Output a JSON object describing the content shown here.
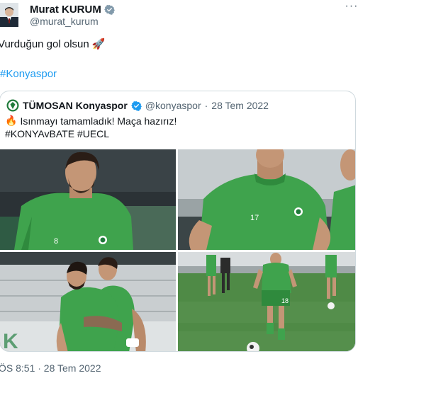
{
  "author": {
    "display_name": "Murat KURUM",
    "handle": "@murat_kurum",
    "verified_icon": "verified-badge-icon",
    "avatar_icon": "profile-avatar"
  },
  "more_label": "···",
  "tweet": {
    "text": "Vurduğun gol olsun 🚀",
    "hashtag": "#Konyaspor",
    "timestamp": "ÖS 8:51 · 28 Tem 2022"
  },
  "quoted": {
    "display_name": "TÜMOSAN Konyaspor",
    "handle": "@konyaspor",
    "separator": "·",
    "date": "28 Tem 2022",
    "fire_emoji": "🔥",
    "line1": "Isınmayı tamamladık! Maça hazırız!",
    "line2": "#KONYAvBATE #UECL"
  },
  "photo_numbers": {
    "p1": "8",
    "p2": "17",
    "p4": "18"
  },
  "colors": {
    "link": "#1d9bf0",
    "secondary_text": "#536471",
    "border": "#cfd9de",
    "jersey_green": "#3fa34d"
  }
}
